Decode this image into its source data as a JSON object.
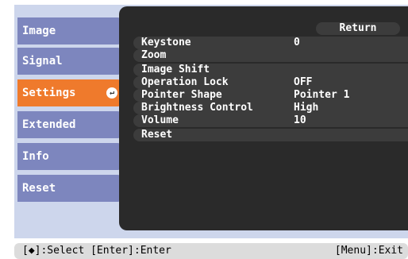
{
  "sidebar": {
    "items": [
      {
        "label": "Image"
      },
      {
        "label": "Signal"
      },
      {
        "label": "Settings"
      },
      {
        "label": "Extended"
      },
      {
        "label": "Info"
      },
      {
        "label": "Reset"
      }
    ],
    "selected_index": 2
  },
  "panel": {
    "return_label": "Return",
    "rows": [
      {
        "label": "Keystone",
        "value": "0"
      },
      {
        "label": "Zoom",
        "value": ""
      },
      {
        "label": "Image Shift",
        "value": ""
      },
      {
        "label": "Operation Lock",
        "value": "OFF"
      },
      {
        "label": "Pointer Shape",
        "value": "Pointer 1"
      },
      {
        "label": "Brightness Control",
        "value": "High"
      },
      {
        "label": "Volume",
        "value": "10"
      },
      {
        "label": "Reset",
        "value": ""
      }
    ]
  },
  "footer": {
    "left": "[◆]:Select [Enter]:Enter",
    "right": "[Menu]:Exit"
  },
  "colors": {
    "sidebar": "#7d86be",
    "sidebar_selected": "#ef7a2c",
    "panel": "#2a2a2a"
  }
}
